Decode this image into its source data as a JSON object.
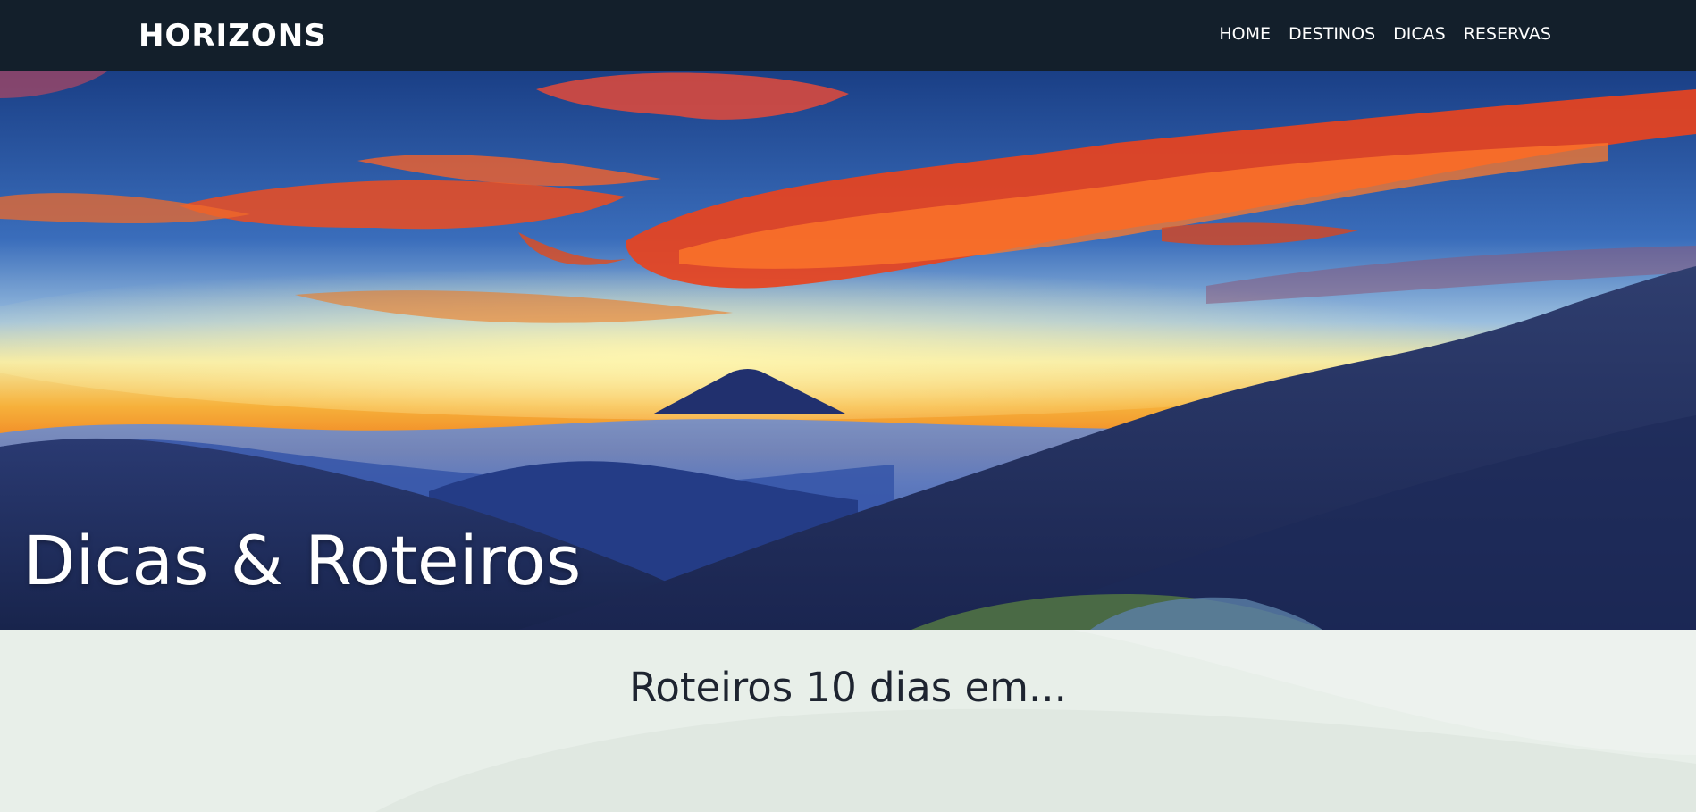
{
  "header": {
    "brand": "HORIZONS",
    "nav": [
      {
        "label": "HOME"
      },
      {
        "label": "DESTINOS"
      },
      {
        "label": "DICAS"
      },
      {
        "label": "RESERVAS"
      }
    ]
  },
  "hero": {
    "title": "Dicas & Roteiros",
    "image": "mountain-sunset-photo"
  },
  "main": {
    "section_title": "Roteiros 10 dias em..."
  },
  "colors": {
    "header_bg": "#131f2b",
    "page_bg": "#e8efe9",
    "text_dark": "#1e2430",
    "text_light": "#ffffff"
  }
}
